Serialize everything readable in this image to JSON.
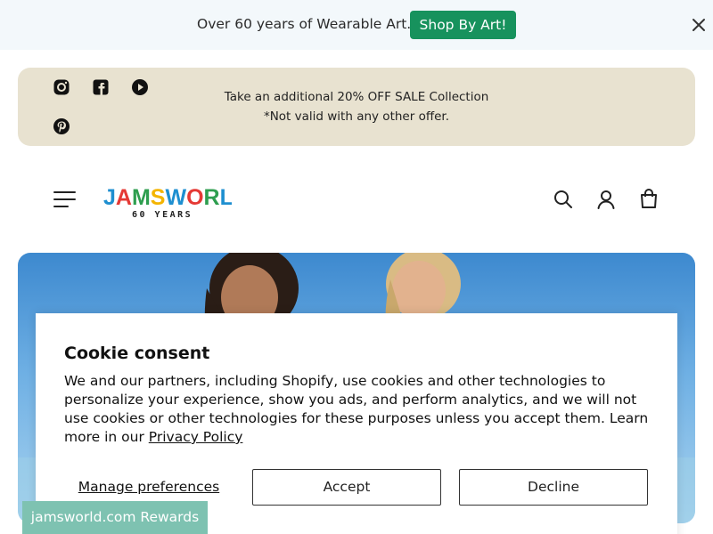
{
  "announcement": {
    "text": "Over 60 years of Wearable Art.",
    "cta_label": "Shop By Art!",
    "close_icon": "close-icon",
    "cta_color": "#17925d",
    "background": "#f3f8fb"
  },
  "promo": {
    "line1": "Take an additional 20% OFF SALE Collection",
    "line2": "*Not valid with any other offer.",
    "background": "#e8e2d0",
    "social_icons": [
      "instagram-icon",
      "facebook-icon",
      "youtube-icon",
      "pinterest-icon"
    ]
  },
  "header": {
    "logo_text": "JAMSWORLD",
    "logo_sub": "60 YEARS",
    "icons": [
      "menu-icon",
      "search-icon",
      "account-icon",
      "cart-icon"
    ]
  },
  "cookie": {
    "title": "Cookie consent",
    "body": "We and our partners, including Shopify, use cookies and other technologies to personalize your experience, show you ads, and perform analytics, and we will not use cookies or other technologies for these purposes unless you accept them. Learn more in our",
    "link_label": "Privacy Policy",
    "manage_label": "Manage preferences",
    "accept_label": "Accept",
    "decline_label": "Decline"
  },
  "rewards": {
    "label": "jamsworld.com Rewards",
    "color": "#7ec2b1"
  }
}
